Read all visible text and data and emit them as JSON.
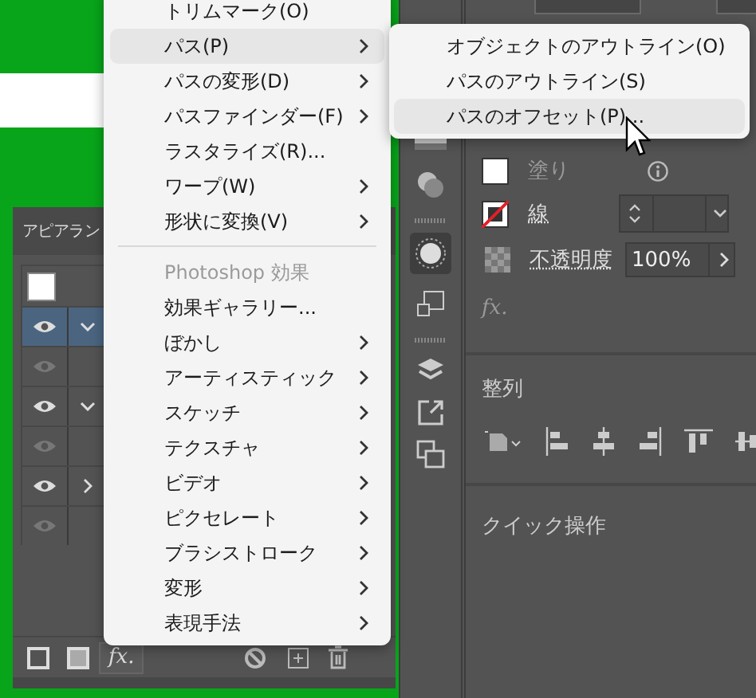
{
  "main_menu": {
    "items": [
      {
        "kind": "item",
        "label": "トリムマーク(O)",
        "has_submenu": false,
        "selected": false
      },
      {
        "kind": "item",
        "label": "パス(P)",
        "has_submenu": true,
        "selected": true
      },
      {
        "kind": "item",
        "label": "パスの変形(D)",
        "has_submenu": true,
        "selected": false
      },
      {
        "kind": "item",
        "label": "パスファインダー(F)",
        "has_submenu": true,
        "selected": false
      },
      {
        "kind": "item",
        "label": "ラスタライズ(R)...",
        "has_submenu": false,
        "selected": false
      },
      {
        "kind": "item",
        "label": "ワープ(W)",
        "has_submenu": true,
        "selected": false
      },
      {
        "kind": "item",
        "label": "形状に変換(V)",
        "has_submenu": true,
        "selected": false
      },
      {
        "kind": "separator"
      },
      {
        "kind": "header",
        "label": "Photoshop 効果"
      },
      {
        "kind": "item",
        "label": "効果ギャラリー...",
        "has_submenu": false,
        "selected": false
      },
      {
        "kind": "item",
        "label": "ぼかし",
        "has_submenu": true,
        "selected": false
      },
      {
        "kind": "item",
        "label": "アーティスティック",
        "has_submenu": true,
        "selected": false
      },
      {
        "kind": "item",
        "label": "スケッチ",
        "has_submenu": true,
        "selected": false
      },
      {
        "kind": "item",
        "label": "テクスチャ",
        "has_submenu": true,
        "selected": false
      },
      {
        "kind": "item",
        "label": "ビデオ",
        "has_submenu": true,
        "selected": false
      },
      {
        "kind": "item",
        "label": "ピクセレート",
        "has_submenu": true,
        "selected": false
      },
      {
        "kind": "item",
        "label": "ブラシストローク",
        "has_submenu": true,
        "selected": false
      },
      {
        "kind": "item",
        "label": "変形",
        "has_submenu": true,
        "selected": false
      },
      {
        "kind": "item",
        "label": "表現手法",
        "has_submenu": true,
        "selected": false
      }
    ]
  },
  "path_submenu": {
    "items": [
      {
        "label": "オブジェクトのアウトライン(O)",
        "selected": false
      },
      {
        "label": "パスのアウトライン(S)",
        "selected": false
      },
      {
        "label": "パスのオフセット(P)...",
        "selected": true
      }
    ]
  },
  "appearance_panel": {
    "title": "アピアラン",
    "rows": [
      {
        "visible": true,
        "expanded": true,
        "selected": true
      },
      {
        "visible": false,
        "selected": false
      },
      {
        "visible": true,
        "expanded": true,
        "selected": false
      },
      {
        "visible": false,
        "selected": false
      },
      {
        "visible": true,
        "expanded": false,
        "selected": false
      },
      {
        "visible": false,
        "selected": false
      }
    ],
    "fx_button": "fx."
  },
  "properties_panel": {
    "fill": {
      "label": "塗り"
    },
    "stroke": {
      "label": "線"
    },
    "opacity": {
      "label": "不透明度",
      "value": "100%"
    },
    "fx_button": "fx.",
    "align": {
      "title": "整列"
    },
    "quick_actions": {
      "title": "クイック操作"
    }
  }
}
